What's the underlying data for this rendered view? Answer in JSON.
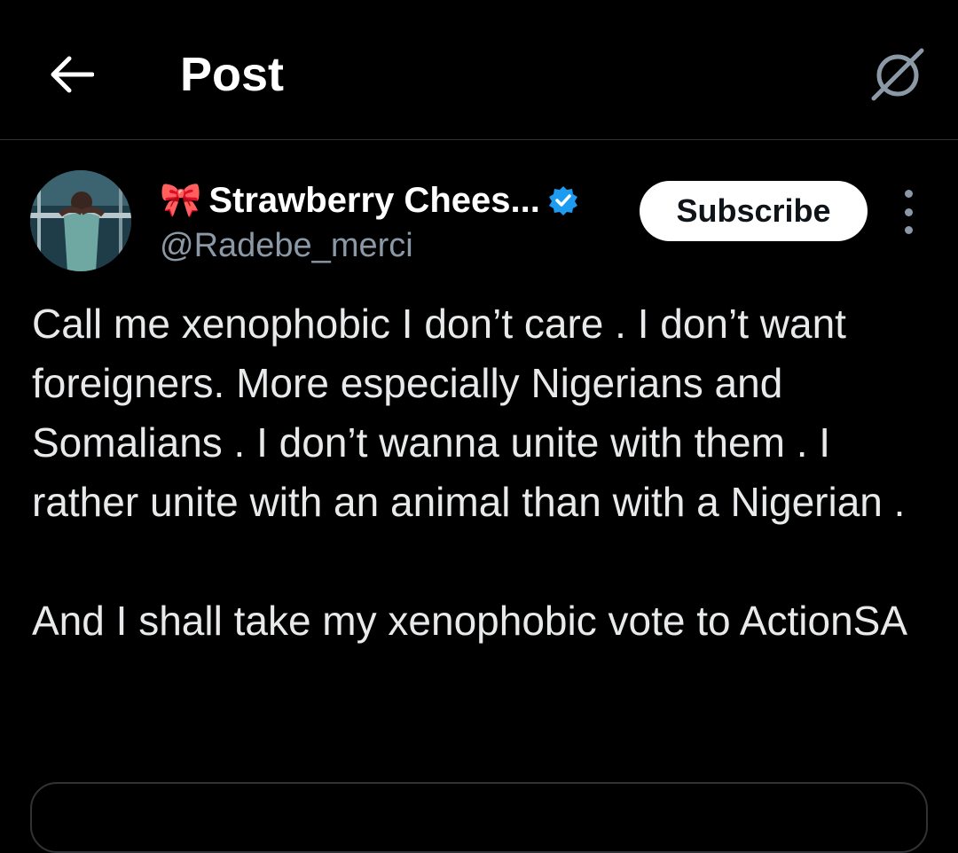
{
  "header": {
    "back_icon": "arrow-left-icon",
    "title": "Post",
    "grok_icon": "grok-icon"
  },
  "post": {
    "author": {
      "prefix_emoji": "🎀",
      "display_name": "Strawberry Chees...",
      "verified_icon": "verified-badge-icon",
      "handle": "@Radebe_merci"
    },
    "subscribe_label": "Subscribe",
    "more_icon": "more-vertical-icon",
    "paragraphs": [
      "Call me xenophobic I don’t care . I don’t want foreigners. More especially Nigerians and Somalians . I don’t wanna unite with them .  I rather unite with an animal than with a Nigerian .",
      "And I shall take my xenophobic vote to ActionSA"
    ]
  },
  "colors": {
    "background": "#000000",
    "text_primary": "#e7e9ea",
    "text_secondary": "#8b98a5",
    "verified_blue": "#1d9bf0",
    "divider": "#2f3336",
    "button_bg": "#ffffff",
    "button_text": "#0f1419"
  }
}
